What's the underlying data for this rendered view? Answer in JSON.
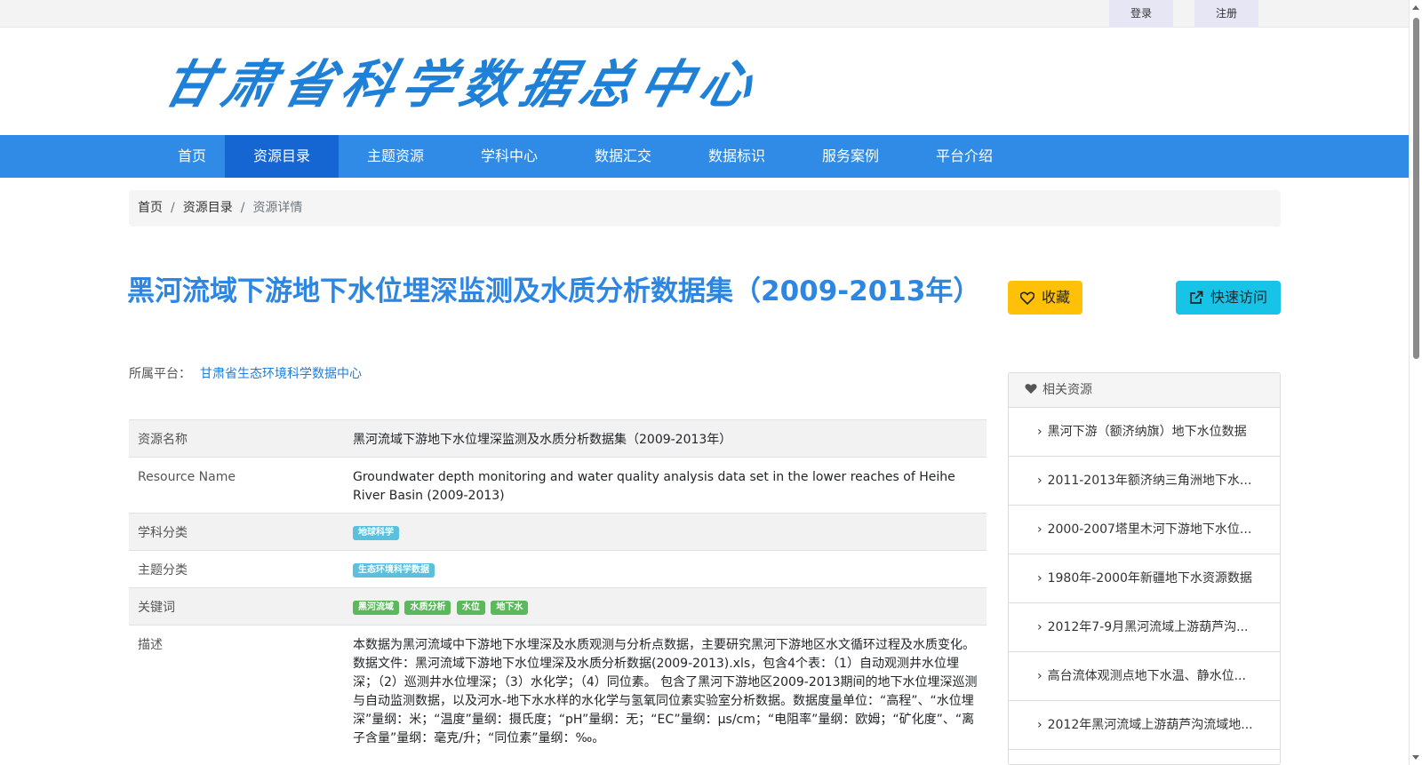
{
  "topbar": {
    "login": "登录",
    "register": "注册"
  },
  "header": {
    "logo_text": "甘肃省科学数据总中心"
  },
  "nav": {
    "items": [
      "首页",
      "资源目录",
      "主题资源",
      "学科中心",
      "数据汇交",
      "数据标识",
      "服务案例",
      "平台介绍"
    ],
    "active": "资源目录"
  },
  "breadcrumb": {
    "home": "首页",
    "catalog": "资源目录",
    "current": "资源详情"
  },
  "resource": {
    "title": "黑河流域下游地下水位埋深监测及水质分析数据集（2009-2013年）",
    "favorite_label": "收藏",
    "quick_access_label": "快速访问",
    "platform_label": "所属平台：",
    "platform_name": "甘肃省生态环境科学数据中心"
  },
  "details": {
    "name_label": "资源名称",
    "name_value": "黑河流域下游地下水位埋深监测及水质分析数据集（2009-2013年）",
    "en_label": "Resource Name",
    "en_value": "Groundwater depth monitoring and water quality analysis data set in the lower reaches of Heihe River Basin (2009-2013)",
    "subject_label": "学科分类",
    "subject_tags": [
      "地球科学"
    ],
    "theme_label": "主题分类",
    "theme_tags": [
      "生态环境科学数据"
    ],
    "keywords_label": "关键词",
    "keywords": [
      "黑河流域",
      "水质分析",
      "水位",
      "地下水"
    ],
    "desc_label": "描述",
    "desc_value": "本数据为黑河流域中下游地下水埋深及水质观测与分析点数据，主要研究黑河下游地区水文循环过程及水质变化。数据文件：黑河流域下游地下水位埋深及水质分析数据(2009-2013).xls，包含4个表：（1）自动观测井水位埋深；（2）巡测井水位埋深；（3）水化学；（4）同位素。 包含了黑河下游地区2009-2013期间的地下水位埋深巡测与自动监测数据，以及河水-地下水水样的水化学与氢氧同位素实验室分析数据。数据度量单位：“高程”、“水位埋深”量纲：米；“温度”量纲：摄氏度；“pH”量纲：无；“EC”量纲：μs/cm；“电阻率”量纲：欧姆；“矿化度”、“离子含量”量纲：毫克/升；“同位素”量纲：‰。"
  },
  "related": {
    "title": "相关资源",
    "items": [
      "黑河下游（额济纳旗）地下水位数据",
      "2011-2013年额济纳三角洲地下水...",
      "2000-2007塔里木河下游地下水位...",
      "1980年-2000年新疆地下水资源数据",
      "2012年7-9月黑河流域上游葫芦沟...",
      "高台流体观测点地下水温、静水位...",
      "2012年黑河流域上游葫芦沟流域地..."
    ]
  }
}
